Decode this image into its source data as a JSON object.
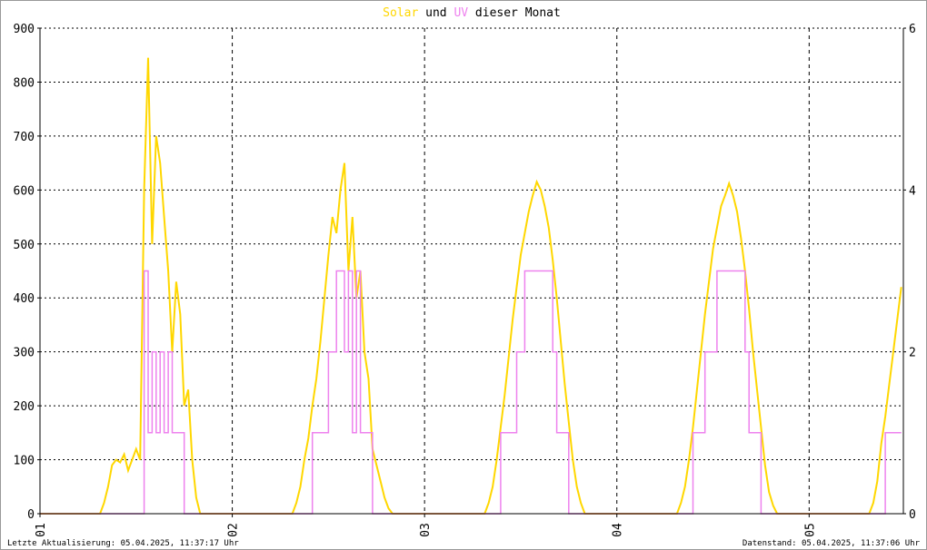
{
  "chart_data": {
    "type": "line",
    "title_parts": [
      {
        "text": "Solar",
        "color": "#FFD700"
      },
      {
        "text": " und ",
        "color": "#000000"
      },
      {
        "text": "UV",
        "color": "#EE82EE"
      },
      {
        "text": " dieser Monat",
        "color": "#000000"
      }
    ],
    "x_ticks": [
      "01",
      "02",
      "03",
      "04",
      "05"
    ],
    "x_range_days": [
      0,
      4.49
    ],
    "y_left": {
      "range": [
        0,
        900
      ],
      "ticks": [
        0,
        100,
        200,
        300,
        400,
        500,
        600,
        700,
        800,
        900
      ],
      "label": "Solar"
    },
    "y_right": {
      "range": [
        0,
        6
      ],
      "ticks": [
        0,
        2,
        4,
        6
      ],
      "label": "UV"
    },
    "grid": true,
    "sample": {
      "start_hour": 7.5,
      "step_hours": 0.5
    },
    "series": [
      {
        "name": "Solar",
        "color": "#FFD700",
        "style": "line",
        "axis": "left",
        "days": [
          [
            0,
            20,
            50,
            90,
            100,
            95,
            110,
            80,
            100,
            120,
            100,
            600,
            845,
            500,
            700,
            650,
            550,
            450,
            300,
            430,
            370,
            200,
            230,
            100,
            30,
            0,
            0
          ],
          [
            0,
            20,
            50,
            100,
            140,
            200,
            250,
            320,
            400,
            480,
            550,
            520,
            600,
            650,
            450,
            550,
            400,
            450,
            300,
            250,
            120,
            90,
            60,
            30,
            10,
            0,
            0
          ],
          [
            0,
            20,
            50,
            100,
            160,
            220,
            290,
            360,
            420,
            480,
            520,
            560,
            590,
            615,
            600,
            570,
            530,
            470,
            400,
            320,
            240,
            170,
            100,
            50,
            20,
            0,
            0
          ],
          [
            0,
            20,
            50,
            100,
            160,
            230,
            300,
            370,
            430,
            490,
            530,
            570,
            590,
            612,
            590,
            560,
            510,
            450,
            380,
            300,
            230,
            160,
            90,
            40,
            15,
            0,
            0
          ],
          [
            0,
            20,
            60,
            130,
            180,
            240,
            300,
            360,
            420,
            440
          ]
        ]
      },
      {
        "name": "UV",
        "color": "#EE82EE",
        "style": "step",
        "axis": "right",
        "days": [
          [
            0,
            0,
            0,
            0,
            0,
            0,
            0,
            0,
            0,
            0,
            0,
            3,
            1,
            2,
            1,
            2,
            1,
            2,
            1,
            1,
            1,
            0,
            0,
            0,
            0,
            0,
            0
          ],
          [
            0,
            0,
            0,
            0,
            0,
            1,
            1,
            1,
            1,
            2,
            2,
            3,
            3,
            2,
            3,
            1,
            3,
            1,
            1,
            1,
            0,
            0,
            0,
            0,
            0,
            0,
            0
          ],
          [
            0,
            0,
            0,
            0,
            1,
            1,
            1,
            1,
            2,
            2,
            3,
            3,
            3,
            3,
            3,
            3,
            3,
            2,
            1,
            1,
            1,
            0,
            0,
            0,
            0,
            0,
            0
          ],
          [
            0,
            0,
            0,
            0,
            1,
            1,
            1,
            2,
            2,
            2,
            3,
            3,
            3,
            3,
            3,
            3,
            3,
            2,
            1,
            1,
            1,
            0,
            0,
            0,
            0,
            0,
            0
          ],
          [
            0,
            0,
            0,
            0,
            1,
            1,
            1,
            1,
            1,
            1
          ]
        ]
      }
    ]
  },
  "footer": {
    "left": "Letzte Aktualisierung: 05.04.2025, 11:37:17 Uhr",
    "right": "Datenstand: 05.04.2025, 11:37:06 Uhr"
  }
}
